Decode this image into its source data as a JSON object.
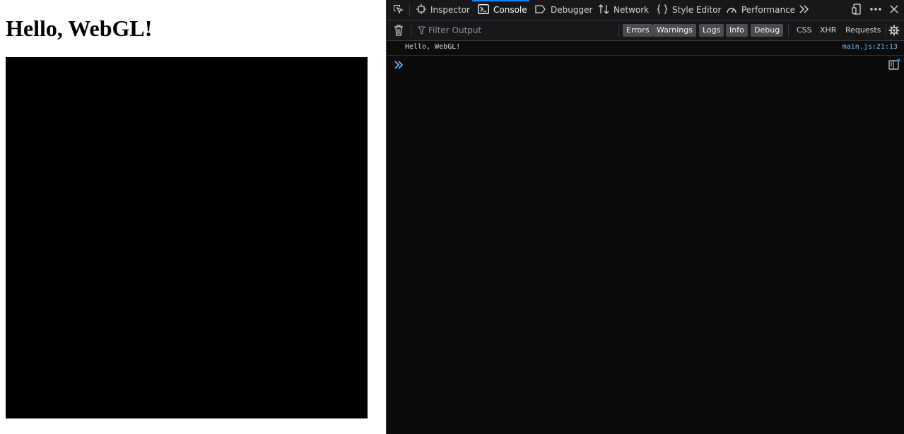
{
  "page": {
    "heading": "Hello, WebGL!"
  },
  "devtools": {
    "tabs": [
      {
        "label": "Inspector",
        "icon": "inspector-icon"
      },
      {
        "label": "Console",
        "icon": "console-icon",
        "selected": true
      },
      {
        "label": "Debugger",
        "icon": "debugger-icon"
      },
      {
        "label": "Network",
        "icon": "network-icon"
      },
      {
        "label": "Style Editor",
        "icon": "style-editor-icon"
      },
      {
        "label": "Performance",
        "icon": "performance-icon"
      }
    ],
    "filter": {
      "placeholder": "Filter Output",
      "levels": [
        "Errors",
        "Warnings",
        "Logs",
        "Info",
        "Debug"
      ],
      "extras": [
        "CSS",
        "XHR",
        "Requests"
      ]
    },
    "messages": [
      {
        "text": "Hello, WebGL!",
        "location": "main.js:21:13"
      }
    ],
    "colors": {
      "accent": "#0a84ff",
      "background": "#0c0c0d",
      "toolbar": "#18181a",
      "link": "#75bfff"
    }
  }
}
